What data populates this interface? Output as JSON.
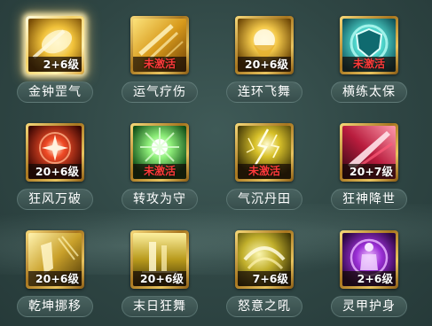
{
  "skills": [
    {
      "name": "金钟罡气",
      "level": "2+6级",
      "active": true,
      "selected": true,
      "icon": "golden-bell-icon",
      "theme": "gold"
    },
    {
      "name": "运气疗伤",
      "level": "未激活",
      "active": false,
      "selected": false,
      "icon": "healing-qi-icon",
      "theme": "gold"
    },
    {
      "name": "连环飞舞",
      "level": "20+6级",
      "active": true,
      "selected": false,
      "icon": "flying-dance-icon",
      "theme": "gold"
    },
    {
      "name": "横练太保",
      "level": "未激活",
      "active": false,
      "selected": false,
      "icon": "shield-icon",
      "theme": "teal"
    },
    {
      "name": "狂风万破",
      "level": "20+6级",
      "active": true,
      "selected": false,
      "icon": "wind-burst-icon",
      "theme": "red"
    },
    {
      "name": "转攻为守",
      "level": "未激活",
      "active": false,
      "selected": false,
      "icon": "green-light-icon",
      "theme": "green"
    },
    {
      "name": "气沉丹田",
      "level": "未激活",
      "active": false,
      "selected": false,
      "icon": "lightning-icon",
      "theme": "gold"
    },
    {
      "name": "狂神降世",
      "level": "20+7级",
      "active": true,
      "selected": false,
      "icon": "crimson-blade-icon",
      "theme": "crimson"
    },
    {
      "name": "乾坤挪移",
      "level": "20+6级",
      "active": true,
      "selected": false,
      "icon": "golden-shield-icon",
      "theme": "gold"
    },
    {
      "name": "末日狂舞",
      "level": "20+6级",
      "active": true,
      "selected": false,
      "icon": "doom-dance-icon",
      "theme": "gold"
    },
    {
      "name": "怒意之吼",
      "level": "7+6级",
      "active": true,
      "selected": false,
      "icon": "roar-icon",
      "theme": "gold"
    },
    {
      "name": "灵甲护身",
      "level": "2+6级",
      "active": true,
      "selected": false,
      "icon": "spirit-armor-icon",
      "theme": "purple"
    }
  ],
  "colors": {
    "inactive_text": "#ff3b3b",
    "level_text": "#ffffff",
    "frame_gold": "#c9962f",
    "background": "#2f4644"
  }
}
